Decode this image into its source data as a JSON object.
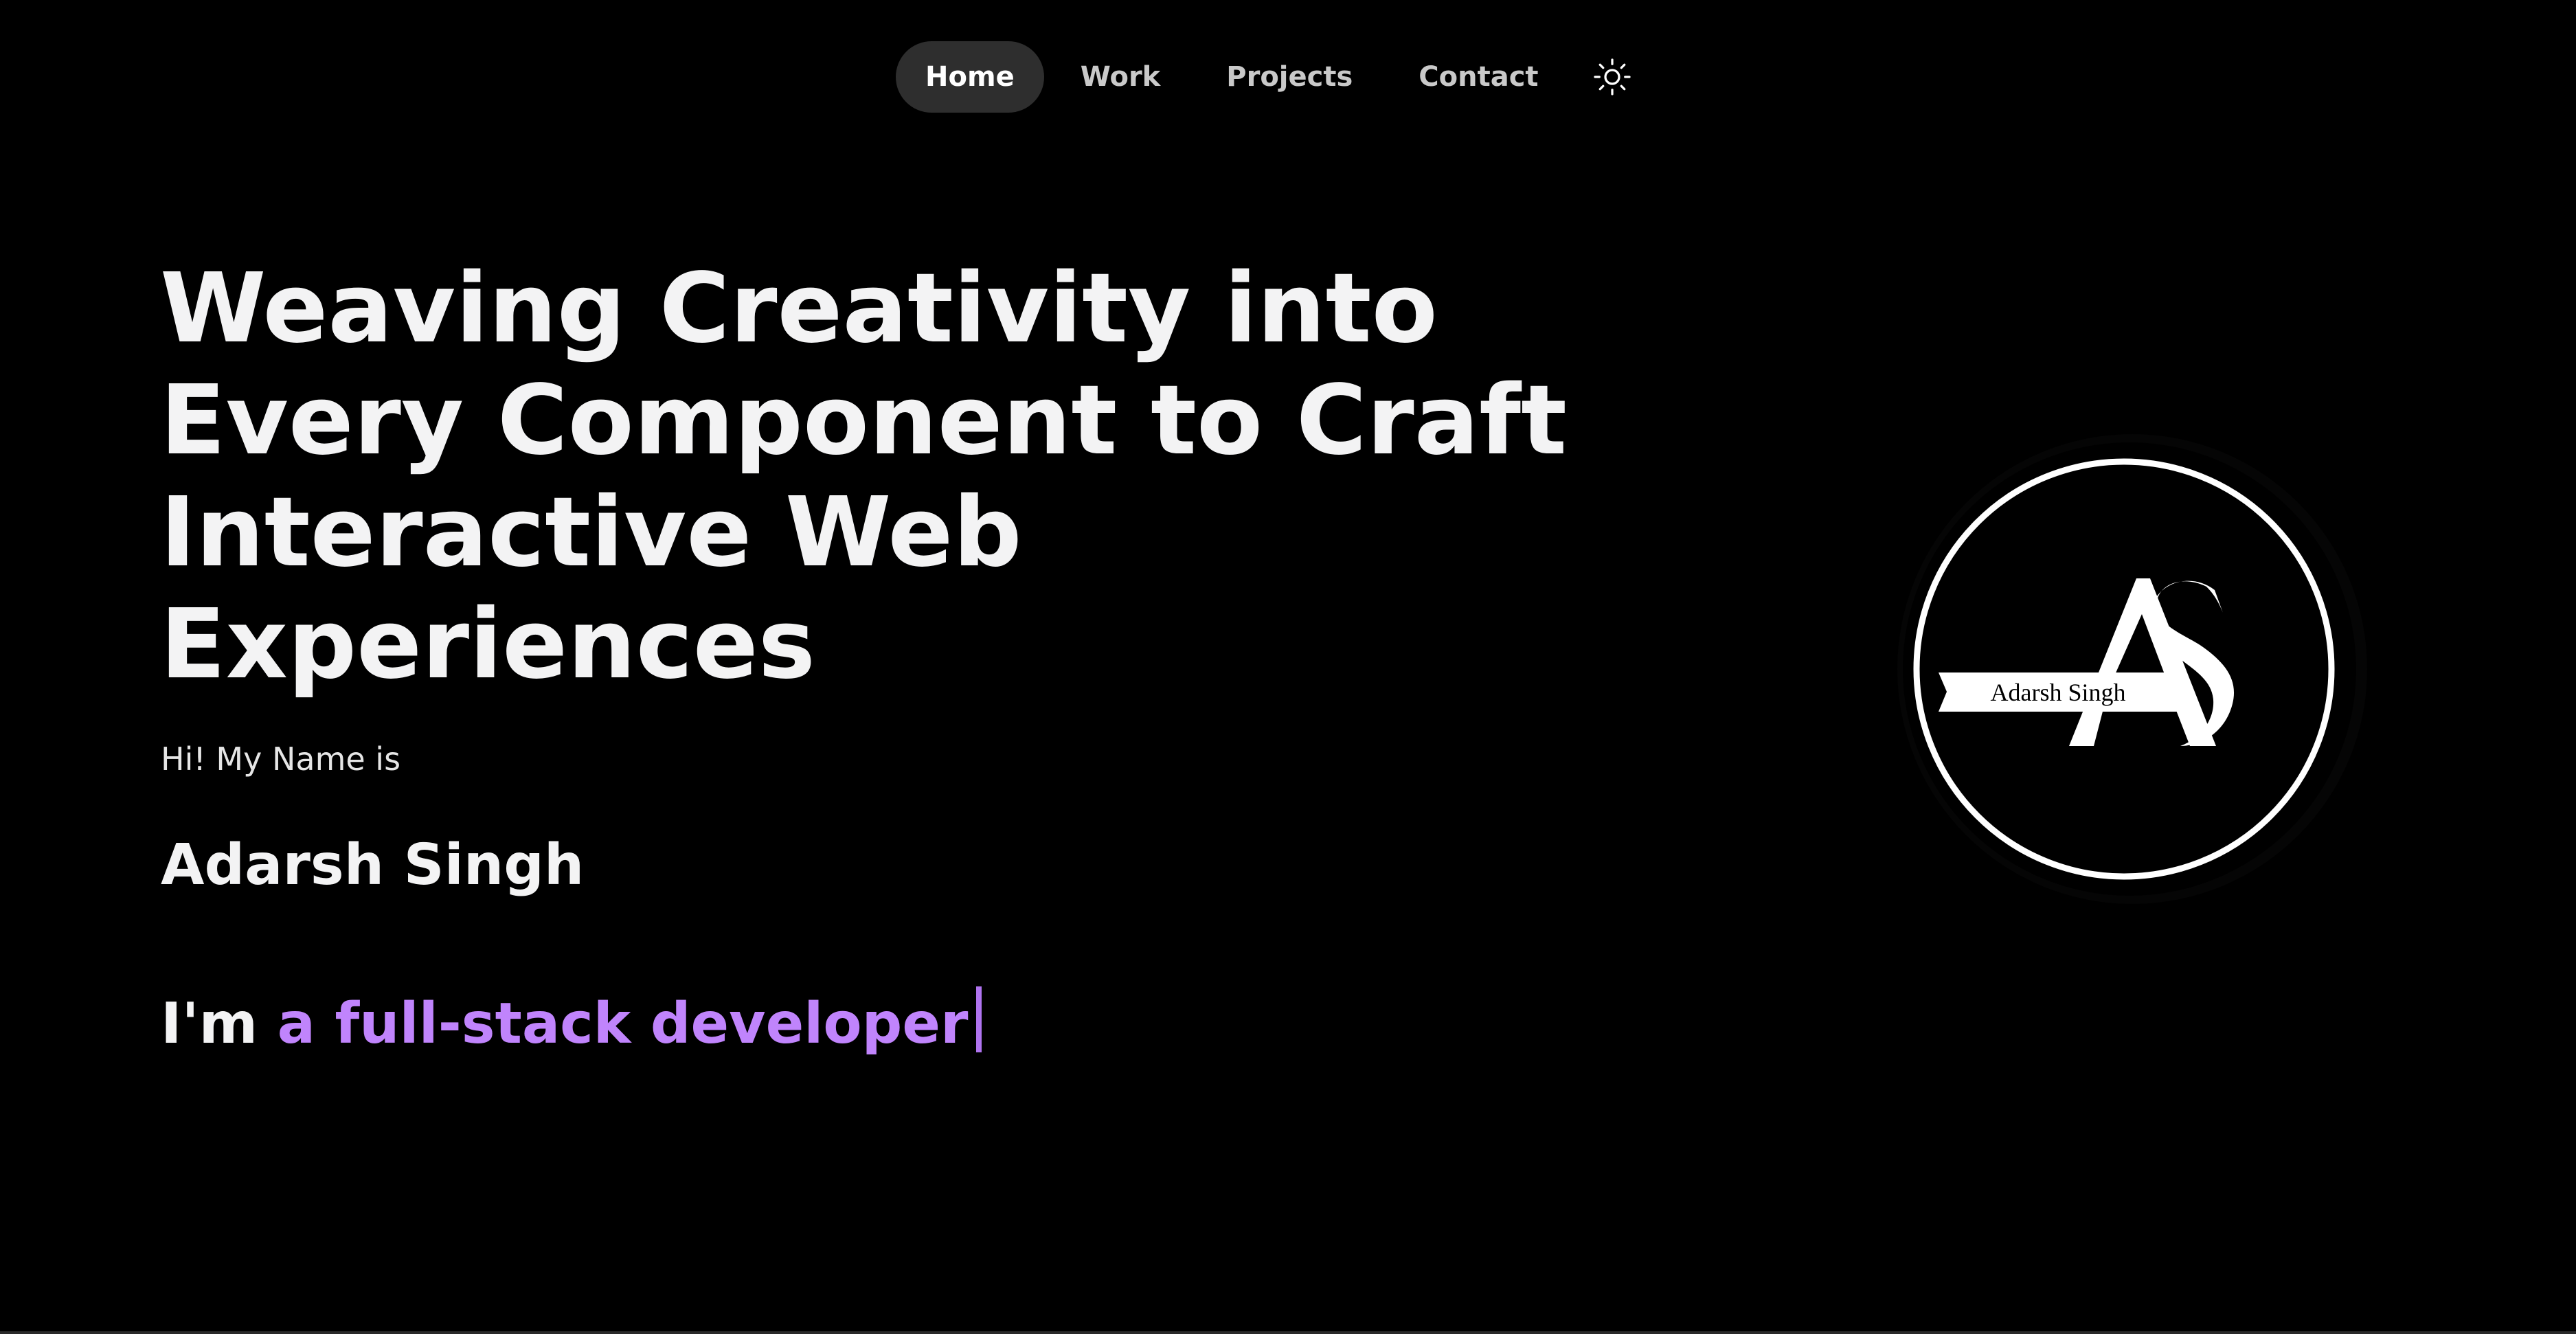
{
  "nav": {
    "items": [
      {
        "label": "Home",
        "active": true
      },
      {
        "label": "Work",
        "active": false
      },
      {
        "label": "Projects",
        "active": false
      },
      {
        "label": "Contact",
        "active": false
      }
    ],
    "theme_toggle_icon": "sun-icon"
  },
  "hero": {
    "headline_lines": [
      "Weaving Creativity into",
      "Every Component to Craft",
      "Interactive Web",
      "Experiences"
    ],
    "greeting": "Hi! My Name is",
    "name": "Adarsh Singh",
    "role_prefix": "I'm",
    "role_text": "a full-stack developer"
  },
  "logo": {
    "monogram": "AS",
    "text": "Adarsh Singh"
  },
  "colors": {
    "background": "#000000",
    "text": "#f3f3f4",
    "accent": "#c084fc",
    "nav_active_bg": "#2e2e2e"
  }
}
